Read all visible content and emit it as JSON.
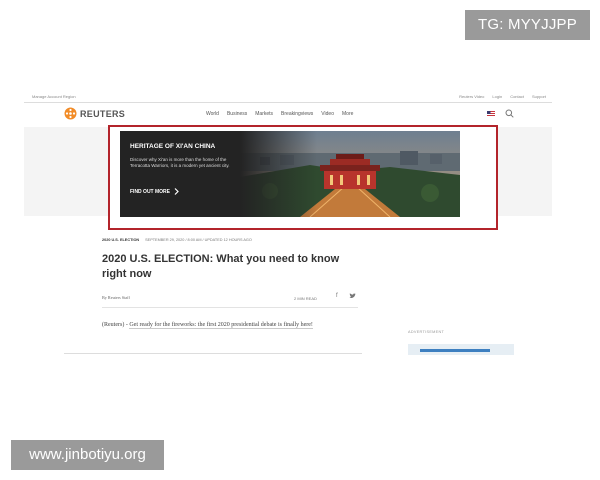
{
  "watermarks": {
    "top_right": "TG: MYYJJPP",
    "bottom_left": "www.jinbotiyu.org"
  },
  "utility_bar": {
    "left_text": "Manage Account Region",
    "links": [
      "Reuters Video",
      "Login",
      "Contact",
      "Support"
    ]
  },
  "nav": {
    "logo_text": "REUTERS",
    "links": [
      "World",
      "Business",
      "Markets",
      "Breakingviews",
      "Video",
      "More"
    ],
    "logo_color": "#f28c28"
  },
  "ad": {
    "title": "HERITAGE OF XI'AN CHINA",
    "body": "Discover why Xi'an is more than the home of the Terracotta Warriors, it is a modern yet ancient city.",
    "cta": "FIND OUT MORE",
    "frame_color": "#b3242b"
  },
  "article": {
    "category": "2020 U.S. ELECTION",
    "dateline": "SEPTEMBER 29, 2020 / 8:00 AM / UPDATED 12 HOURS AGO",
    "title": "2020 U.S. ELECTION: What you need to know right now",
    "byline": "By Reuters Staff",
    "read_time": "2 MIN READ",
    "share_fb": "f",
    "lede_prefix": "(Reuters) - ",
    "lede_text": "Get ready for the fireworks: the first 2020 presidential debate is finally here!"
  },
  "sidebar": {
    "advert_label": "ADVERTISEMENT"
  }
}
